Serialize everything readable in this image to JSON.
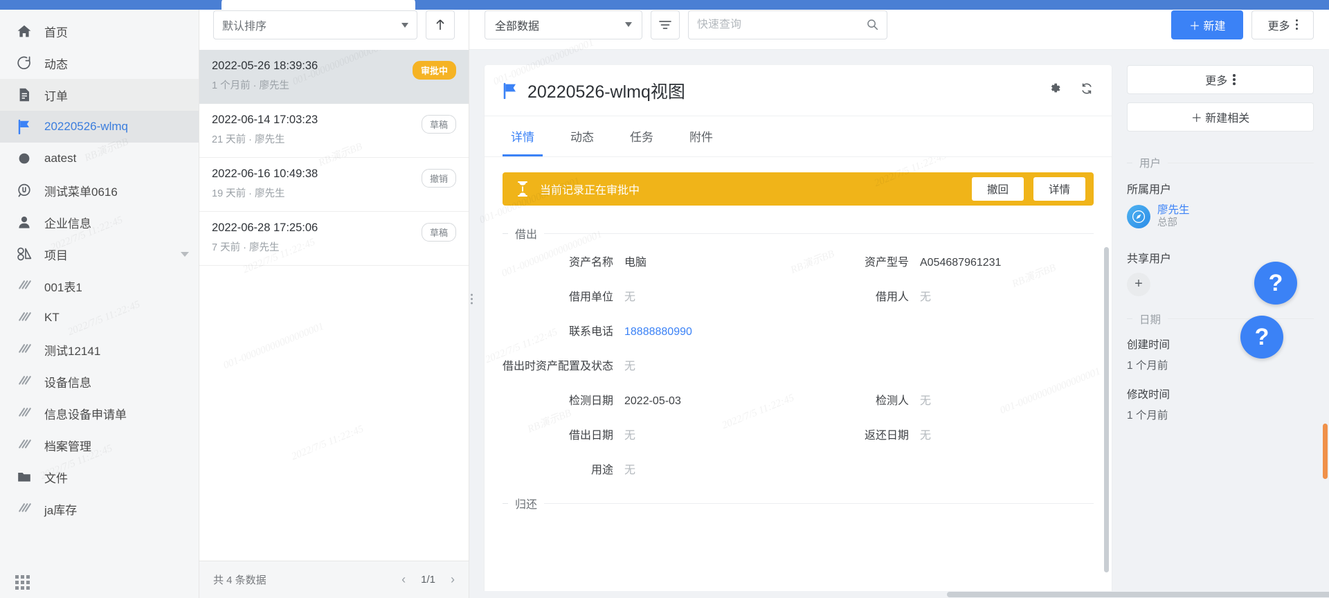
{
  "sidebar": {
    "items": [
      {
        "label": "首页",
        "icon": "home-icon",
        "state": "normal"
      },
      {
        "label": "动态",
        "icon": "activity-icon",
        "state": "normal"
      },
      {
        "label": "订单",
        "icon": "document-icon",
        "state": "shaded"
      },
      {
        "label": "20220526-wlmq",
        "icon": "flag-icon",
        "state": "active"
      },
      {
        "label": "aatest",
        "icon": "circle-icon",
        "state": "normal"
      },
      {
        "label": "测试菜单0616",
        "icon": "chat-icon",
        "state": "normal"
      },
      {
        "label": "企业信息",
        "icon": "person-icon",
        "state": "normal"
      },
      {
        "label": "项目",
        "icon": "project-icon",
        "state": "normal",
        "caret": true
      },
      {
        "label": "001表1",
        "icon": "table-icon",
        "state": "normal"
      },
      {
        "label": "KT",
        "icon": "table-icon",
        "state": "normal"
      },
      {
        "label": "测试12141",
        "icon": "table-icon",
        "state": "normal"
      },
      {
        "label": "设备信息",
        "icon": "table-icon",
        "state": "normal"
      },
      {
        "label": "信息设备申请单",
        "icon": "table-icon",
        "state": "normal"
      },
      {
        "label": "档案管理",
        "icon": "table-icon",
        "state": "normal"
      },
      {
        "label": "文件",
        "icon": "folder-icon",
        "state": "normal"
      },
      {
        "label": "ja库存",
        "icon": "table-icon",
        "state": "normal"
      }
    ]
  },
  "list_panel": {
    "sort_label": "默认排序",
    "sort_direction_icon": "arrow-up-icon",
    "rows": [
      {
        "title": "2022-05-26 18:39:36",
        "sub": "1 个月前 · 廖先生",
        "badge": "审批中",
        "badge_style": "warn",
        "selected": true
      },
      {
        "title": "2022-06-14 17:03:23",
        "sub": "21 天前 · 廖先生",
        "badge": "草稿",
        "badge_style": "plain",
        "selected": false
      },
      {
        "title": "2022-06-16 10:49:38",
        "sub": "19 天前 · 廖先生",
        "badge": "撤销",
        "badge_style": "plain",
        "selected": false
      },
      {
        "title": "2022-06-28 17:25:06",
        "sub": "7 天前 · 廖先生",
        "badge": "草稿",
        "badge_style": "plain",
        "selected": false
      }
    ],
    "footer_total": "共 4 条数据",
    "page_indicator": "1/1"
  },
  "toolbar": {
    "data_scope": "全部数据",
    "search_placeholder": "快速查询",
    "search_value": "",
    "new_label": "＋ 新建",
    "more_label": "更多"
  },
  "card": {
    "title": "20220526-wlmq视图",
    "tabs": [
      {
        "label": "详情",
        "active": true
      },
      {
        "label": "动态",
        "active": false
      },
      {
        "label": "任务",
        "active": false
      },
      {
        "label": "附件",
        "active": false
      }
    ],
    "alert": {
      "text": "当前记录正在审批中",
      "icon": "hourglass-icon",
      "buttons": [
        "撤回",
        "详情"
      ]
    },
    "sections": [
      {
        "legend": "借出",
        "rows": [
          [
            {
              "label": "资产名称",
              "value": "电脑",
              "style": "normal"
            },
            {
              "label": "资产型号",
              "value": "A054687961231",
              "style": "normal"
            }
          ],
          [
            {
              "label": "借用单位",
              "value": "无",
              "style": "none"
            },
            {
              "label": "借用人",
              "value": "无",
              "style": "none"
            }
          ],
          [
            {
              "label": "联系电话",
              "value": "18888880990",
              "style": "link"
            }
          ],
          [
            {
              "label": "借出时资产配置及状态",
              "value": "无",
              "style": "none"
            }
          ],
          [
            {
              "label": "检测日期",
              "value": "2022-05-03",
              "style": "normal"
            },
            {
              "label": "检测人",
              "value": "无",
              "style": "none"
            }
          ],
          [
            {
              "label": "借出日期",
              "value": "无",
              "style": "none"
            },
            {
              "label": "返还日期",
              "value": "无",
              "style": "none"
            }
          ],
          [
            {
              "label": "用途",
              "value": "无",
              "style": "none"
            }
          ]
        ]
      },
      {
        "legend": "归还",
        "rows": []
      }
    ]
  },
  "rail": {
    "more_label": "更多",
    "new_related_label": "＋ 新建相关",
    "user_section": "用户",
    "owner_label": "所属用户",
    "owner_name": "廖先生",
    "owner_dept": "总部",
    "shared_label": "共享用户",
    "date_section": "日期",
    "created_label": "创建时间",
    "created_value": "1 个月前",
    "modified_label": "修改时间",
    "modified_value": "1 个月前"
  },
  "help": {
    "glyph": "?"
  },
  "watermarks": [
    "RB演示BB",
    "2022/7/5 11:22:45",
    "001-00000000000000001"
  ],
  "colors": {
    "accent": "#3b82f6",
    "warning": "#f0b419",
    "sidebar_bg": "#f5f6f7",
    "page_bg": "#f0f2f5"
  }
}
